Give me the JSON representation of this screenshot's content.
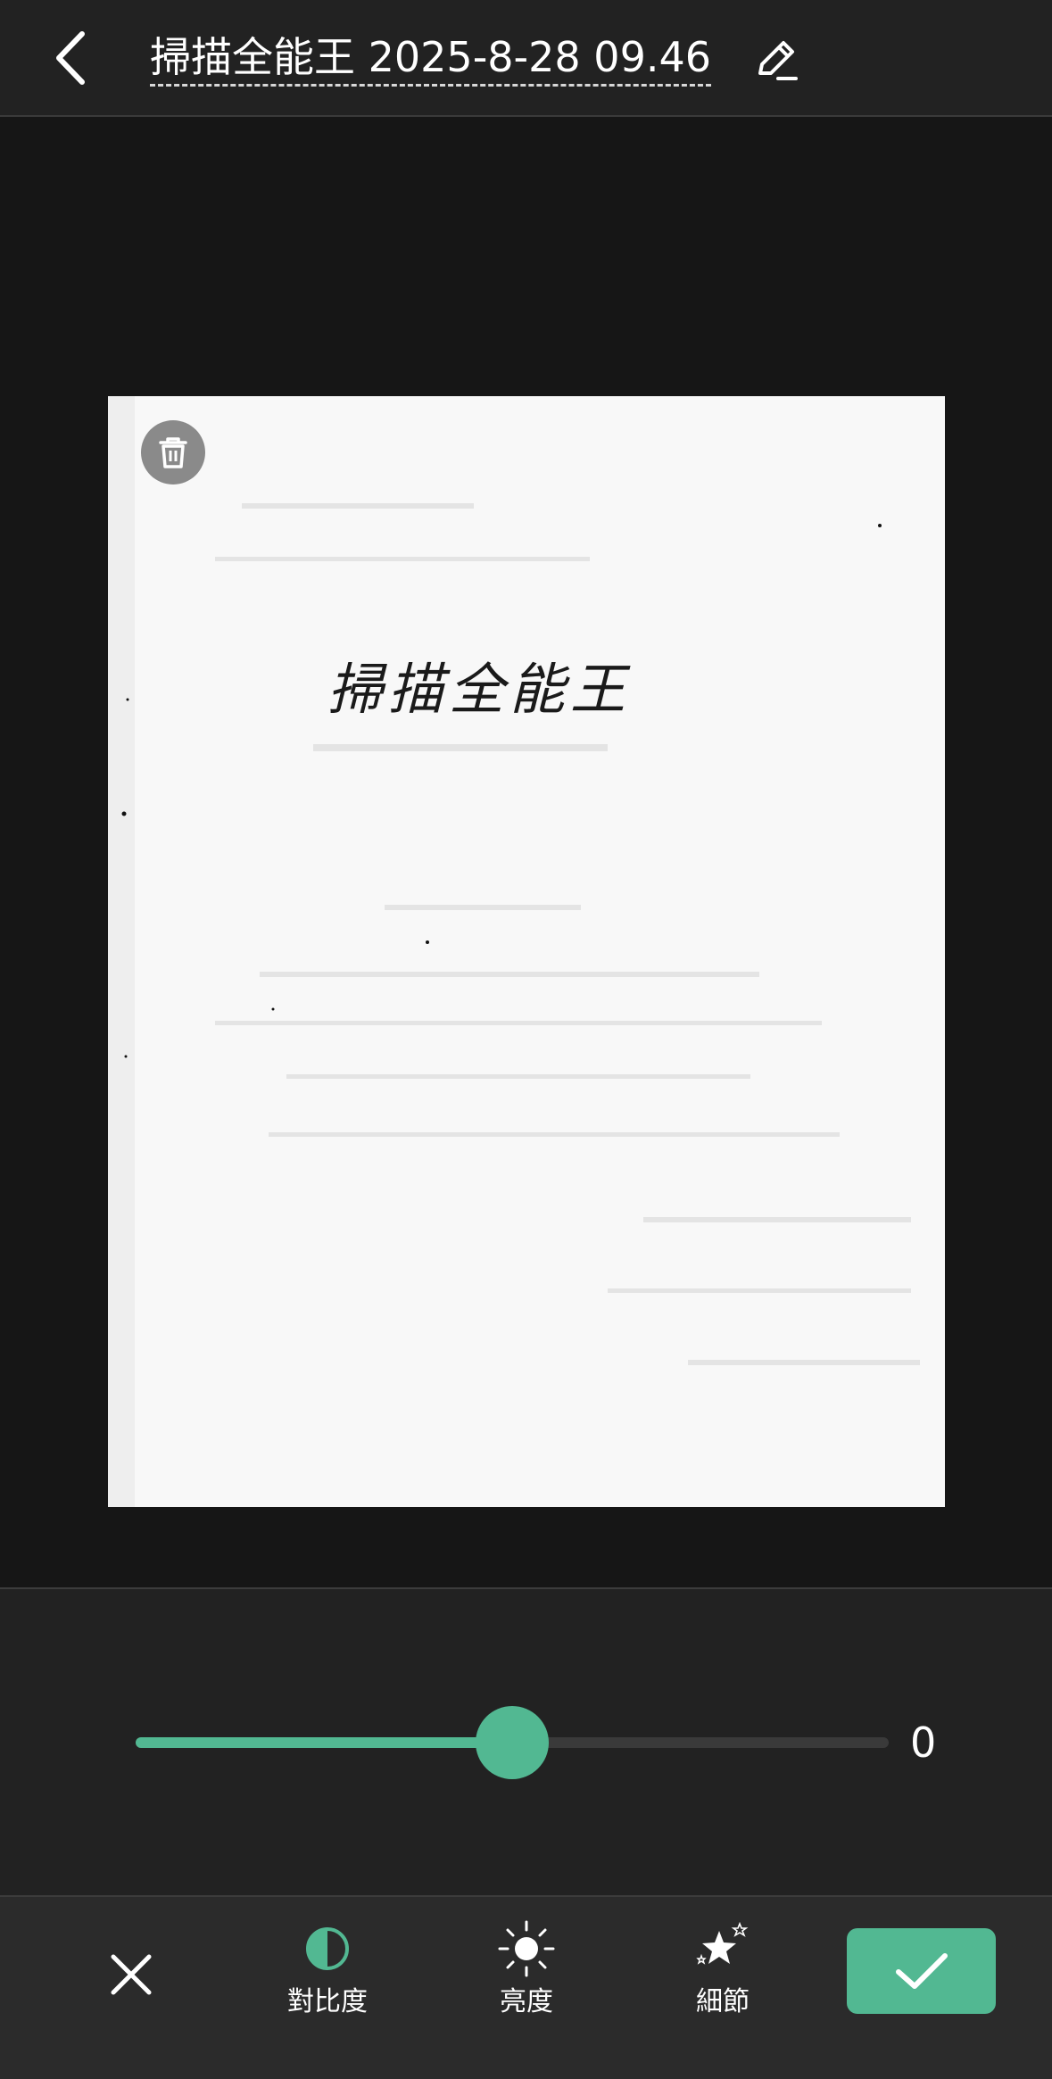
{
  "header": {
    "title": "掃描全能王 2025-8-28 09.46",
    "back_icon": "chevron-left-icon",
    "edit_icon": "pencil-icon"
  },
  "document": {
    "handwritten_text": "掃描全能王",
    "delete_icon": "trash-icon"
  },
  "adjust": {
    "slider_value": "0",
    "slider_level_percent": 50,
    "accent_color": "#52b892"
  },
  "toolbar": {
    "close_icon": "close-icon",
    "tools": [
      {
        "label": "對比度",
        "icon": "contrast-icon"
      },
      {
        "label": "亮度",
        "icon": "brightness-icon"
      },
      {
        "label": "細節",
        "icon": "sparkle-star-icon"
      }
    ],
    "confirm_icon": "checkmark-icon"
  }
}
